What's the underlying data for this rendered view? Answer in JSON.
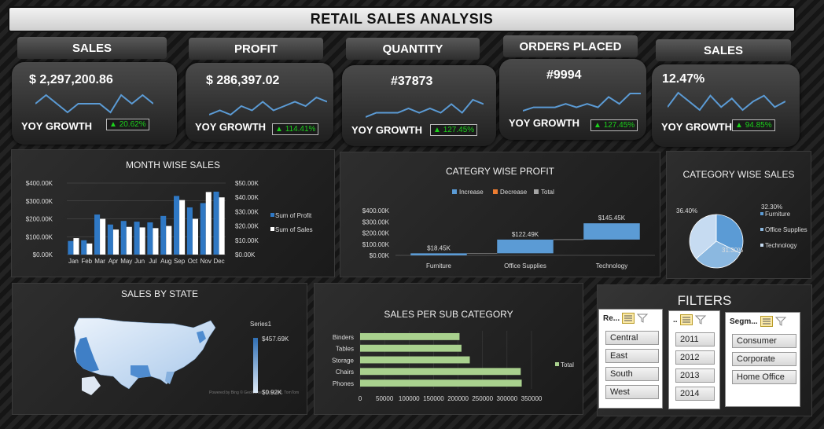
{
  "title": "RETAIL SALES ANALYSIS",
  "kpis": [
    {
      "header": "SALES",
      "value": "$ 2,297,200.86",
      "yoy_label": "YOY GROWTH",
      "yoy": "20.62%",
      "spark": [
        5,
        6,
        5,
        4,
        5,
        5,
        5,
        4,
        6,
        5,
        6,
        5
      ]
    },
    {
      "header": "PROFIT",
      "value": "$ 286,397.02",
      "yoy_label": "YOY GROWTH",
      "yoy": "114.41%",
      "spark": [
        4,
        5,
        4,
        6,
        5,
        7,
        5,
        6,
        7,
        6,
        8,
        7
      ]
    },
    {
      "header": "QUANTITY",
      "value": "#37873",
      "yoy_label": "YOY GROWTH",
      "yoy": "127.45%",
      "spark": [
        4,
        5,
        5,
        5,
        6,
        5,
        6,
        5,
        7,
        5,
        8,
        7
      ]
    },
    {
      "header": "ORDERS PLACED",
      "value": "#9994",
      "yoy_label": "YOY GROWTH",
      "yoy": "127.45%",
      "spark": [
        4,
        5,
        5,
        5,
        6,
        5,
        6,
        5,
        8,
        6,
        9,
        9
      ]
    },
    {
      "header": "SALES",
      "value": "12.47%",
      "yoy_label": "YOY GROWTH",
      "yoy": "94.85%",
      "spark": [
        4,
        9,
        6,
        3,
        8,
        4,
        7,
        3,
        6,
        8,
        4,
        6
      ]
    }
  ],
  "icons": {
    "arrow": "triangle-up-icon",
    "filter": "clear-filter-icon",
    "multi_select": "multi-select-icon"
  },
  "chart_data": [
    {
      "type": "bar",
      "title": "MONTH WISE SALES",
      "categories": [
        "Jan",
        "Feb",
        "Mar",
        "Apr",
        "May",
        "Jun",
        "Jul",
        "Aug",
        "Sep",
        "Oct",
        "Nov",
        "Dec"
      ],
      "series": [
        {
          "name": "Sum of Profit",
          "values": [
            9500,
            10000,
            28000,
            21000,
            23500,
            23000,
            22500,
            27000,
            41000,
            33000,
            36000,
            44000
          ],
          "color": "#2f78c4"
        },
        {
          "name": "Sum of Sales",
          "values": [
            92000,
            62000,
            200000,
            140000,
            155000,
            152000,
            148000,
            160000,
            305000,
            200000,
            350000,
            320000
          ],
          "color": "#ffffff"
        }
      ],
      "y_ticks": [
        "$0.00K",
        "$100.00K",
        "$200.00K",
        "$300.00K",
        "$400.00K"
      ],
      "y2_ticks": [
        "$0.00K",
        "$10.00K",
        "$20.00K",
        "$30.00K",
        "$40.00K",
        "$50.00K"
      ],
      "ylim": [
        0,
        400000
      ],
      "y2lim": [
        0,
        50000
      ],
      "legend": "right"
    },
    {
      "type": "bar",
      "title": "CATEGRY WISE PROFIT",
      "subtype": "waterfall",
      "categories": [
        "Furniture",
        "Office Supplies",
        "Technology"
      ],
      "values": [
        18450,
        122490,
        145450
      ],
      "labels": [
        "$18.45K",
        "$122.49K",
        "$145.45K"
      ],
      "legend": [
        "Increase",
        "Decrease",
        "Total"
      ],
      "legend_colors": [
        "#5b9bd5",
        "#ed7d31",
        "#a5a5a5"
      ],
      "y_ticks": [
        "$0.00K",
        "$100.00K",
        "$200.00K",
        "$300.00K",
        "$400.00K"
      ],
      "ylim": [
        0,
        400000
      ]
    },
    {
      "type": "pie",
      "title": "CATEGORY WISE SALES",
      "labels": [
        "Furniture",
        "Office Supplies",
        "Technology"
      ],
      "values": [
        32.3,
        31.3,
        36.4
      ],
      "pct_labels": [
        "32.30%",
        "31.30%",
        "36.40%"
      ],
      "colors": [
        "#5b9bd5",
        "#8bb8e0",
        "#c6dbf1"
      ],
      "legend": "right"
    },
    {
      "type": "bar",
      "title": "SALES PER SUB CATEGORY",
      "orientation": "horizontal",
      "categories": [
        "Binders",
        "Tables",
        "Storage",
        "Chairs",
        "Phones"
      ],
      "values": [
        203000,
        207000,
        224000,
        328000,
        330000
      ],
      "series_name": "Total",
      "x_ticks": [
        "0",
        "50000",
        "100000",
        "150000",
        "200000",
        "250000",
        "300000",
        "350000"
      ],
      "xlim": [
        0,
        350000
      ],
      "color": "#a9d18e"
    }
  ],
  "map": {
    "title": "SALES BY STATE",
    "legend_title": "Series1",
    "max": "$457.69K",
    "min": "$0.92K",
    "attribution": "Powered by Bing © GeoNames, Microsoft, TomTom"
  },
  "filters": {
    "title": "FILTERS",
    "slicers": [
      {
        "header": "Re...",
        "items": [
          "Central",
          "East",
          "South",
          "West"
        ]
      },
      {
        "header": "..",
        "items": [
          "2011",
          "2012",
          "2013",
          "2014"
        ]
      },
      {
        "header": "Segm...",
        "items": [
          "Consumer",
          "Corporate",
          "Home Office"
        ]
      }
    ]
  }
}
